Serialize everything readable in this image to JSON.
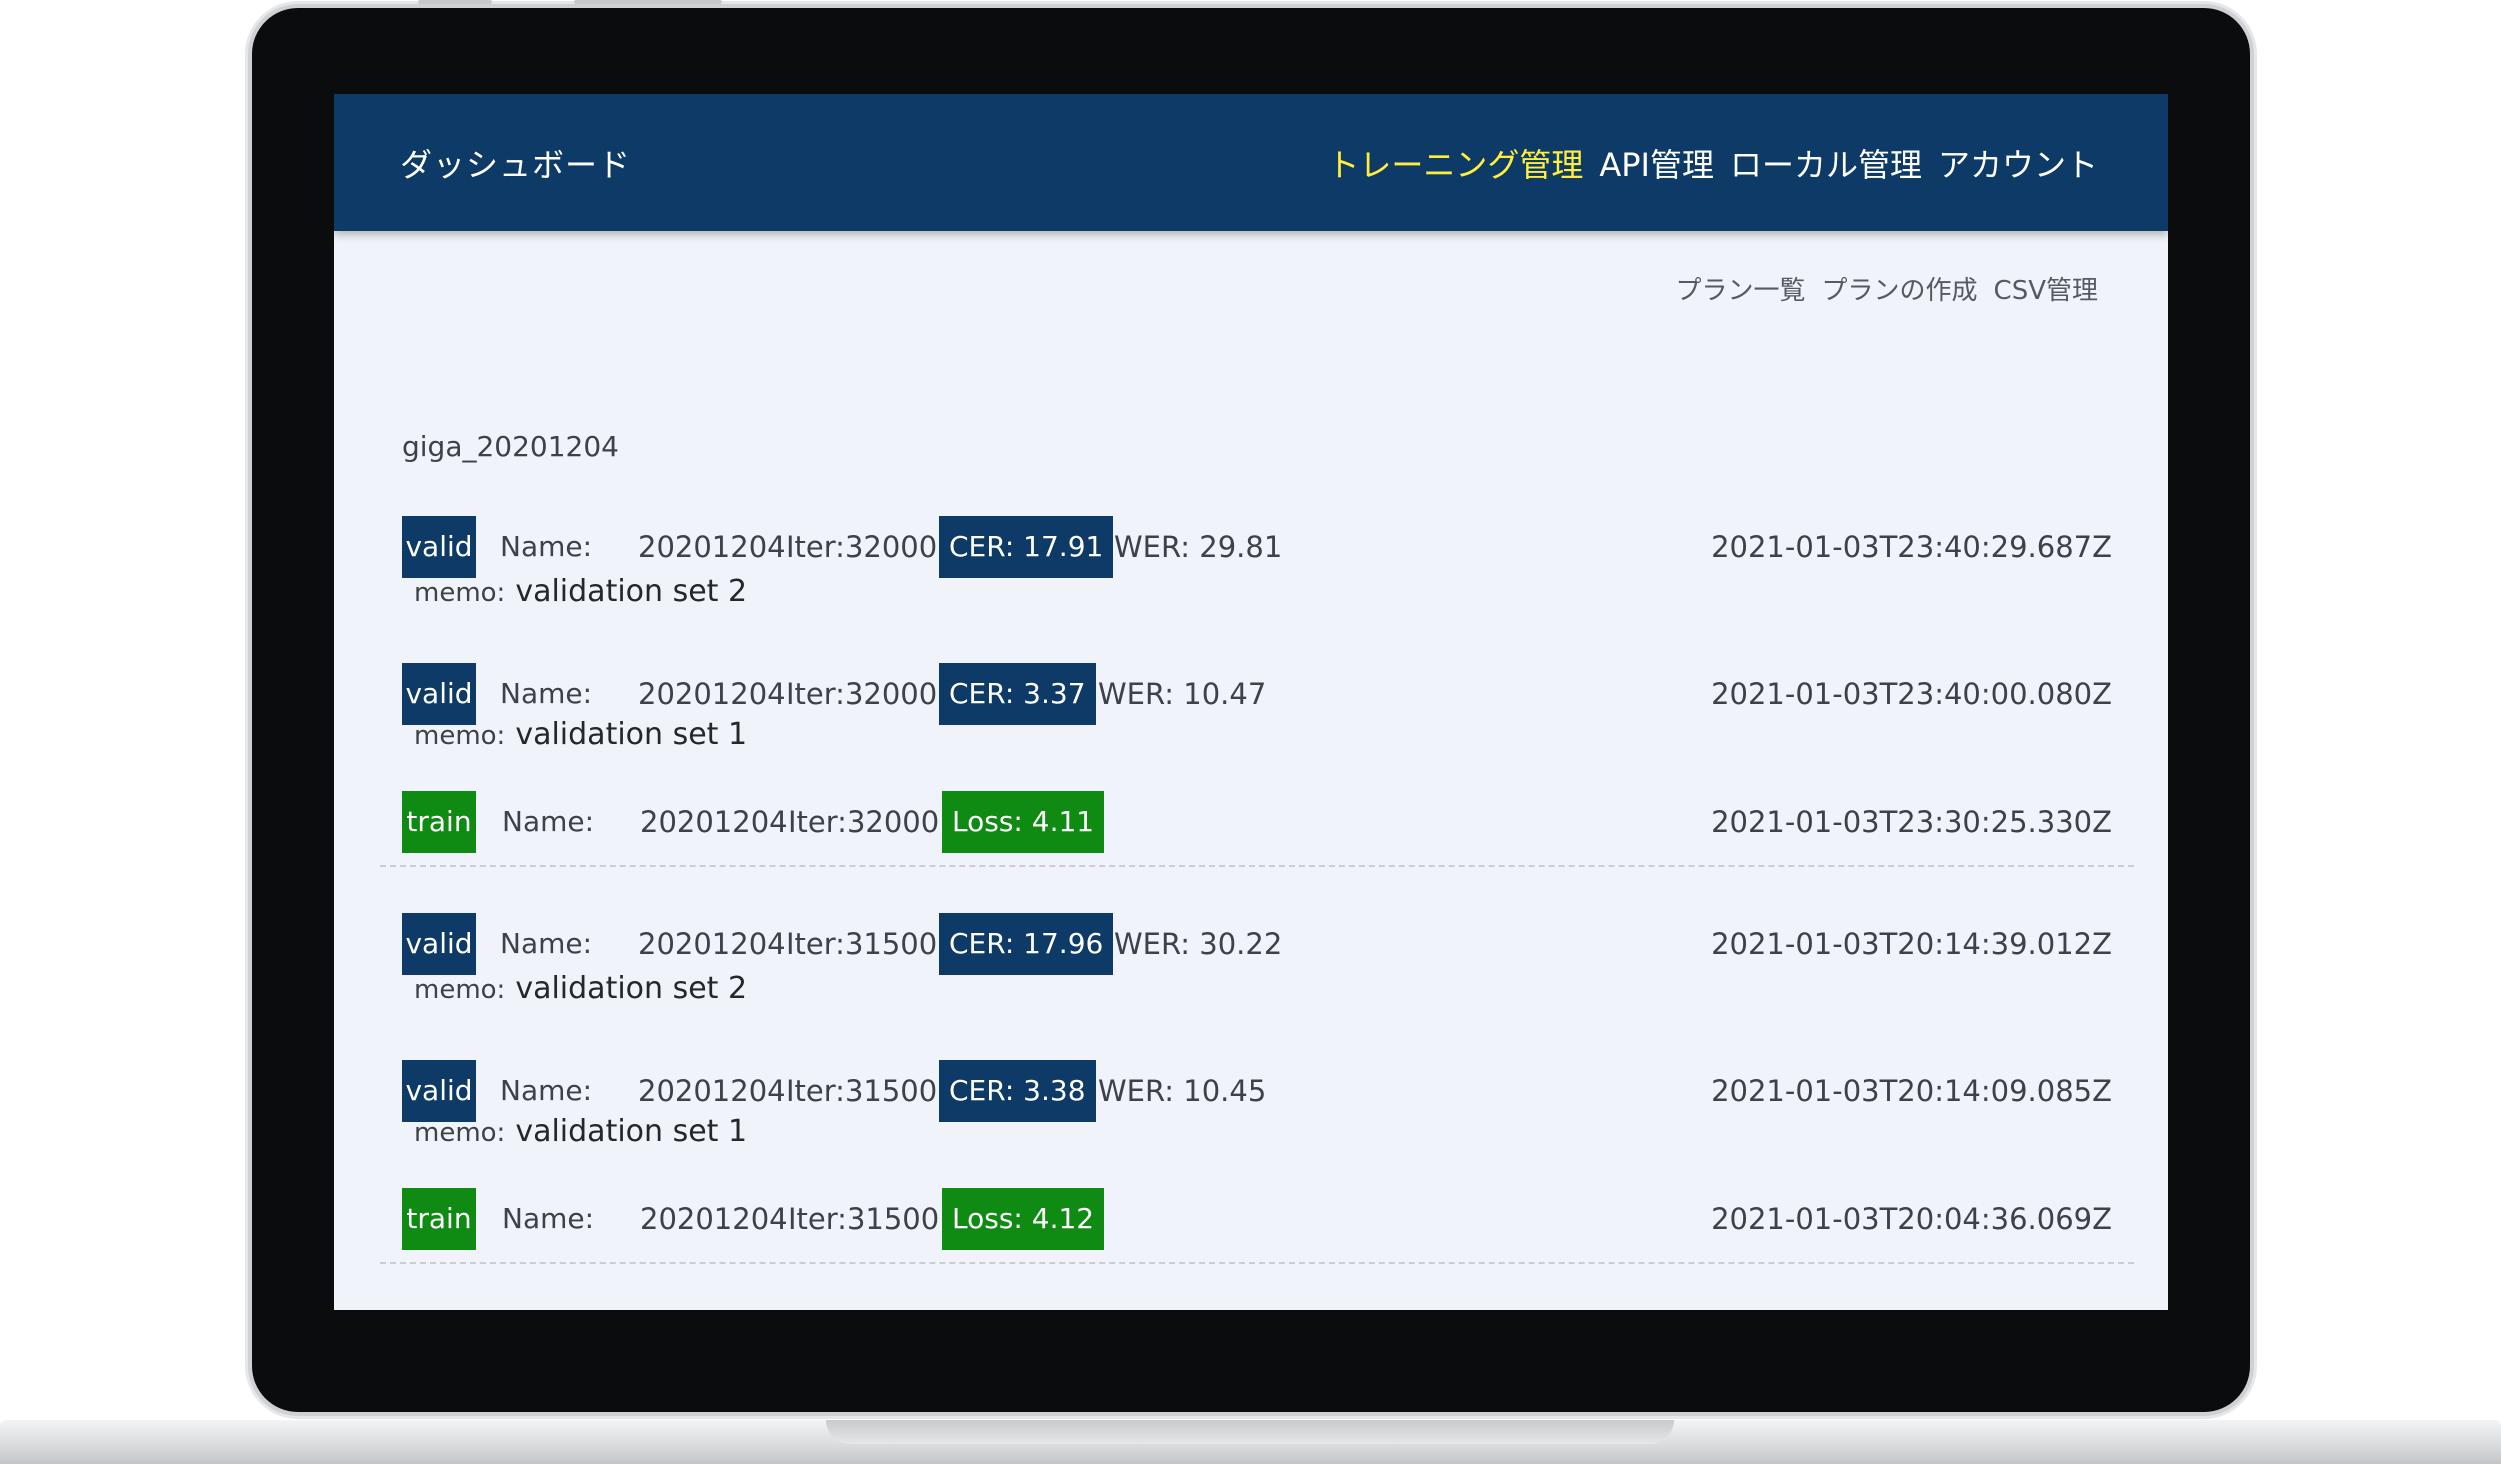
{
  "header": {
    "brand": "ダッシュボード",
    "nav": [
      "トレーニング管理",
      "API管理",
      "ローカル管理",
      "アカウント"
    ],
    "active_nav": 0,
    "active_color": "#ffee3b",
    "bar_color": "#0d3a66"
  },
  "subnav": [
    "プラン一覧",
    "プランの作成",
    "CSV管理"
  ],
  "plan": {
    "title": "giga_20201204"
  },
  "labels": {
    "name": "Name:",
    "memo": "memo:"
  },
  "badge_colors": {
    "valid": "#0d3a66",
    "train": "#0f8a12"
  },
  "records": [
    {
      "type": "valid",
      "name": "20201204",
      "iter": "Iter:32000",
      "metric": "CER: 17.91",
      "wer": "WER: 29.81",
      "memo": "validation set 2",
      "timestamp": "2021-01-03T23:40:29.687Z"
    },
    {
      "type": "valid",
      "name": "20201204",
      "iter": "Iter:32000",
      "metric": "CER: 3.37",
      "wer": "WER: 10.47",
      "memo": "validation set 1",
      "timestamp": "2021-01-03T23:40:00.080Z"
    },
    {
      "type": "train",
      "name": "20201204",
      "iter": "Iter:32000",
      "metric": "Loss: 4.11",
      "wer": "",
      "memo": "",
      "timestamp": "2021-01-03T23:30:25.330Z"
    },
    {
      "type": "valid",
      "name": "20201204",
      "iter": "Iter:31500",
      "metric": "CER: 17.96",
      "wer": "WER: 30.22",
      "memo": "validation set 2",
      "timestamp": "2021-01-03T20:14:39.012Z"
    },
    {
      "type": "valid",
      "name": "20201204",
      "iter": "Iter:31500",
      "metric": "CER: 3.38",
      "wer": "WER: 10.45",
      "memo": "validation set 1",
      "timestamp": "2021-01-03T20:14:09.085Z"
    },
    {
      "type": "train",
      "name": "20201204",
      "iter": "Iter:31500",
      "metric": "Loss: 4.12",
      "wer": "",
      "memo": "",
      "timestamp": "2021-01-03T20:04:36.069Z"
    }
  ]
}
